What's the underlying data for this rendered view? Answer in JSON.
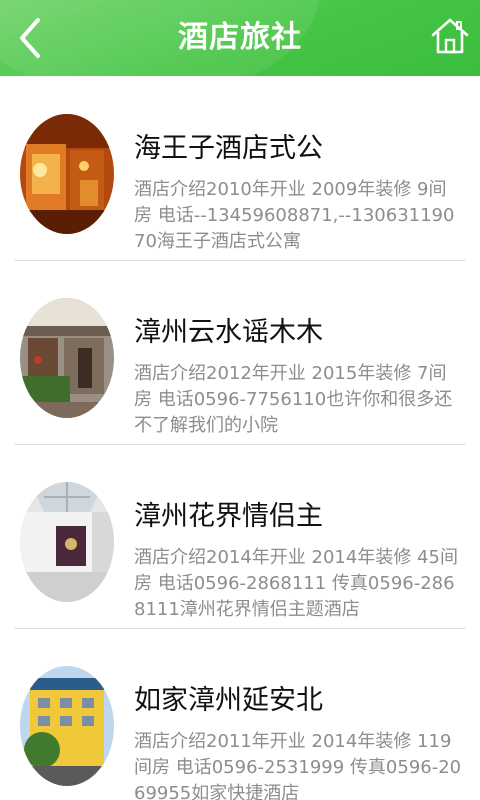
{
  "header": {
    "title": "酒店旅社",
    "back_icon": "chevron-left-icon",
    "home_icon": "home-icon",
    "background": "#46c545"
  },
  "hotels": [
    {
      "name": "海王子酒店式公",
      "description": "酒店介绍2010年开业 2009年装修 9间房 电话--13459608871,--13063119070海王子酒店式公寓"
    },
    {
      "name": "漳州云水谣木木",
      "description": "酒店介绍2012年开业 2015年装修 7间房 电话0596-7756110也许你和很多还不了解我们的小院"
    },
    {
      "name": "漳州花界情侣主",
      "description": "酒店介绍2014年开业 2014年装修 45间房 电话0596-2868111 传真0596-2868111漳州花界情侣主题酒店"
    },
    {
      "name": "如家漳州延安北",
      "description": "酒店介绍2011年开业 2014年装修 119间房 电话0596-2531999 传真0596-2069955如家快捷酒店"
    }
  ]
}
